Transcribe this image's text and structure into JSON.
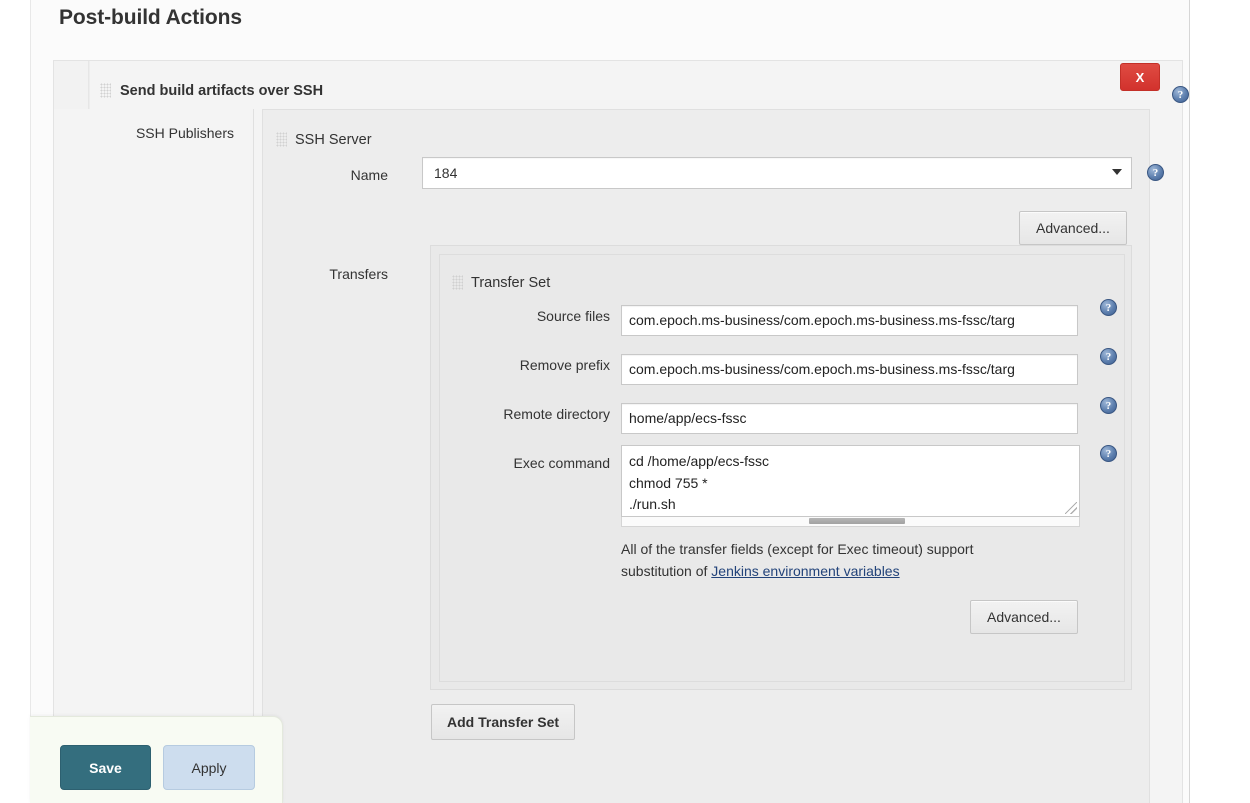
{
  "page": {
    "title": "Post-build Actions"
  },
  "publisher": {
    "header": "Send build artifacts over SSH",
    "close_label": "X",
    "help_icon": "help-icon",
    "grip_icon": "drag-grip-icon",
    "sidebar_label": "SSH Publishers"
  },
  "ssh_server": {
    "title": "SSH Server",
    "name_label": "Name",
    "name_value": "184",
    "name_options": [
      "184"
    ],
    "advanced_label": "Advanced..."
  },
  "transfers": {
    "label": "Transfers",
    "set_title": "Transfer Set",
    "fields": [
      {
        "label": "Source files",
        "value": "com.epoch.ms-business/com.epoch.ms-business.ms-fssc/targ",
        "name": "source-files"
      },
      {
        "label": "Remove prefix",
        "value": "com.epoch.ms-business/com.epoch.ms-business.ms-fssc/targ",
        "name": "remove-prefix"
      },
      {
        "label": "Remote directory",
        "value": "home/app/ecs-fssc",
        "name": "remote-directory"
      }
    ],
    "exec_label": "Exec command",
    "exec_value": "cd /home/app/ecs-fssc\nchmod 755 *\n./run.sh",
    "note_text": "All of the transfer fields (except for Exec timeout) support substitution of ",
    "note_link": "Jenkins environment variables",
    "advanced_label": "Advanced...",
    "add_transfer_set_label": "Add Transfer Set"
  },
  "actions": {
    "save_label": "Save",
    "apply_label": "Apply"
  },
  "colors": {
    "save_bg": "#346e7e",
    "apply_bg": "#cdddee",
    "close_bg": "#d2322d",
    "link": "#22437a"
  }
}
